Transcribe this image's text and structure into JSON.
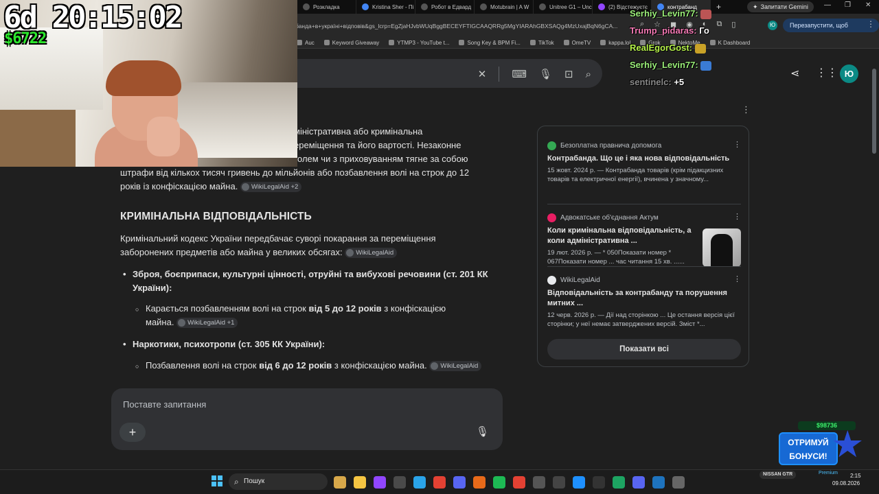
{
  "browser": {
    "tabs": [
      {
        "label": "Розкладка",
        "fav": "dark"
      },
      {
        "label": "Kristina Sher - Пі",
        "fav": "google"
      },
      {
        "label": "Робот в Едвард",
        "fav": "dark"
      },
      {
        "label": "Motubrain | A W",
        "fav": "dark"
      },
      {
        "label": "Unitree G1 – Unc",
        "fav": "dark"
      },
      {
        "label": "(2) Відстежуєтє",
        "fav": "twitch"
      },
      {
        "label": "контрабанд",
        "fav": "google"
      }
    ],
    "new_tab": "+",
    "gemini_button": "Запитати Gemini",
    "url": "банда+в+україні+відповів&gs_lcrp=EgZjaHJvbWUqBggBECEYFTIGCAAQRRg5MgYIARAhGBXSAQg4MzUxajBqN6gCA...",
    "profile_initial": "Ю",
    "relaunch_button": "Перезапустити, щоб оновити",
    "bookmarks": [
      "Auc",
      "Keyword Giveaway",
      "YTMP3 - YouTube t...",
      "Song Key & BPM Fi...",
      "TikTok",
      "OmeTV",
      "kappa.lol",
      "Grok",
      "NektoMe",
      "K Dashboard"
    ]
  },
  "google": {
    "avatar_initial": "Ю",
    "answer": {
      "p1_lines": [
        "міністративна або кримінальна",
        "ереміщення та його вартості. Незаконне",
        "олем чи з приховуванням тягне за собою",
        "штрафи від кількох тисяч гривень до мільйонів або позбавлення волі на строк до 12",
        "років із конфіскацією майна."
      ],
      "p1_chip": "WikiLegalAid +2",
      "heading": "КРИМІНАЛЬНА ВІДПОВІДАЛЬНІСТЬ",
      "p2": "Кримінальний кодекс України передбачає суворі покарання за переміщення заборонених предметів або майна у великих обсягах:",
      "p2_chip": "WikiLegalAid",
      "b1": "Зброя, боєприпаси, культурні цінності, отруйні та вибухові речовини (ст. 201 КК України):",
      "s1_pre": "Карається позбавленням волі на строк ",
      "s1_bold": "від 5 до 12 років",
      "s1_post": " з конфіскацією майна.",
      "s1_chip": "WikiLegalAid +1",
      "b2": "Наркотики, психотропи (ст. 305 КК України):",
      "s2_pre": "Позбавлення волі на строк ",
      "s2_bold": "від 6 до 12 років",
      "s2_post": " з конфіскацією майна.",
      "s2_chip": "WikiLegalAid"
    },
    "followup_placeholder": "Поставте запитання",
    "sources": [
      {
        "site": "Безоплатна правнича допомога",
        "title": "Контрабанда. Що це і яка нова відповідальність",
        "snippet": "15 жовт. 2024 р. — Контрабанда товарів (крім підакцизних товарів та електричної енергії), вчинена у значному...",
        "color": "#34a853"
      },
      {
        "site": "Адвокатське об'єднання Актум",
        "title": "Коли кримінальна відповідальність, а коли адміністративна ...",
        "snippet": "19 лют. 2026 р. — * 050Показати номер * 067Показати номер ... час читання 15 хв. ......",
        "color": "#e91e63"
      },
      {
        "site": "WikiLegalAid",
        "title": "Відповідальність за контрабанду та порушення митних ...",
        "snippet": "12 черв. 2026 р. — Дії над сторінкою ... Це остання версія цієї сторінки; у неї немає затверджених версій. Зміст *...",
        "color": "#e8eaed"
      }
    ],
    "show_all": "Показати всі"
  },
  "stream": {
    "timer": "6d 20:15:02",
    "money": "$6722",
    "chat": [
      {
        "user": "Serhiy_Levin77:",
        "text": "",
        "ucls": "u-green",
        "emote": "#b55"
      },
      {
        "user": "Trump_pidaras:",
        "text": "Го",
        "ucls": "u-pink",
        "emote": ""
      },
      {
        "user": "RealEgorGost:",
        "text": "",
        "ucls": "u-lime",
        "emote": "#c9a227"
      },
      {
        "user": "Serhiy_Levin77:",
        "text": "",
        "ucls": "u-green",
        "emote": "#3a7bd5"
      },
      {
        "user": "sentinelc:",
        "text": "+5",
        "ucls": "u-grey",
        "emote": ""
      }
    ],
    "promo_amount": "$98736",
    "promo_line1": "ОТРИМУЙ",
    "promo_line2": "БОНУСИ!"
  },
  "taskbar": {
    "search": "Пошук",
    "apps": [
      "#d8a84a",
      "#f5c542",
      "#9146ff",
      "#4a4a4a",
      "#2aa3e8",
      "#e34133",
      "#5865f2",
      "#e86a1a",
      "#1db954",
      "#e34133",
      "#555",
      "#444",
      "#1e90ff",
      "#333",
      "#1da462",
      "#5865f2",
      "#1e73be",
      "#666"
    ],
    "nissan": "NISSAN GTR",
    "premium": "Premium",
    "time": "2:15",
    "date": "09.08.2026"
  }
}
